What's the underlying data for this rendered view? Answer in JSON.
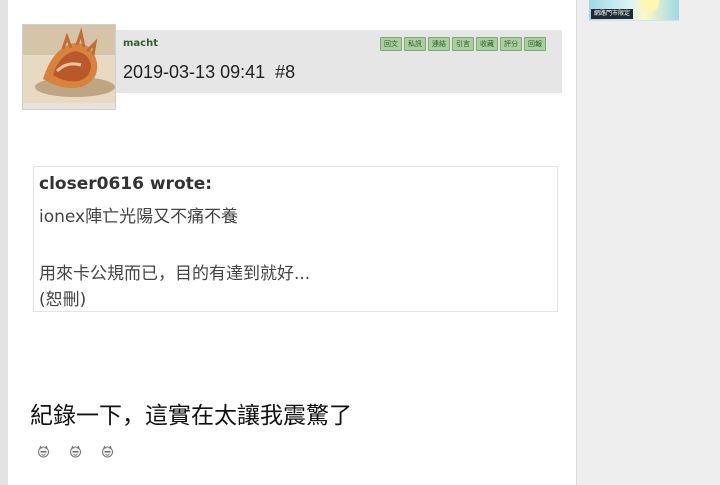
{
  "post": {
    "username": "macht",
    "timestamp": "2019-03-13 09:41",
    "floor": "#8",
    "actions": [
      "回文",
      "私訊",
      "連結",
      "引言",
      "收藏",
      "評分",
      "回報"
    ],
    "quote": {
      "author": "closer0616 wrote:",
      "lines": [
        "ionex陣亡光陽又不痛不養",
        "用來卡公規而已，目的有達到就好...",
        "(恕刪)"
      ]
    },
    "body": "紀錄一下，這實在太讓我震驚了",
    "emoji": [
      "face-icon",
      "face-icon",
      "face-icon"
    ]
  },
  "sidebar": {
    "banner_text": "網路門市限定"
  },
  "colors": {
    "header_bg": "#e6e6e6",
    "action_btn_bg": "#a9cfa0",
    "username": "#2f5f2f",
    "sidebar_bg": "#eeeeee"
  }
}
